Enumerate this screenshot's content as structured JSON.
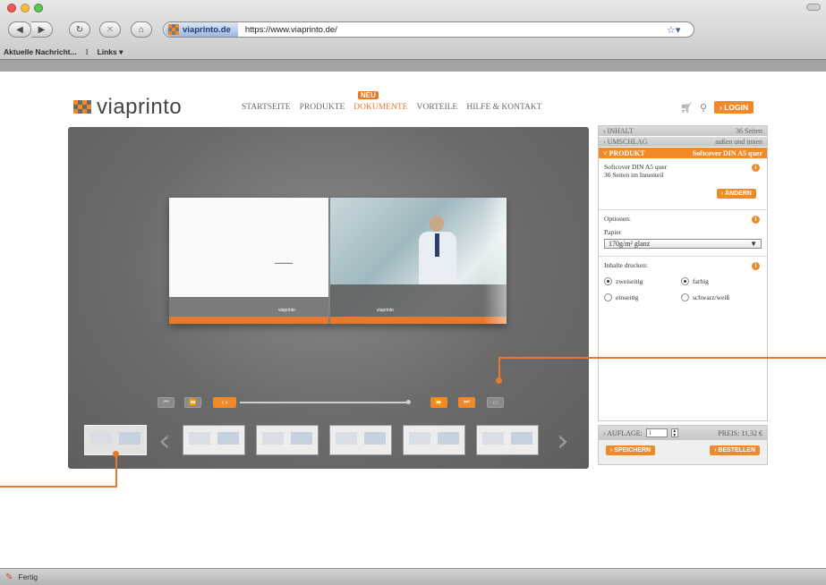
{
  "browser": {
    "site_badge": "viaprinto.de",
    "url": "https://www.viaprinto.de/",
    "star": "☆▾",
    "bookmarks": [
      "Aktuelle Nachricht...",
      "Links ▾"
    ],
    "status": "Fertig"
  },
  "site": {
    "logo_text": "viaprinto",
    "nav": [
      "STARTSEITE",
      "PRODUKTE",
      "DOKUMENTE",
      "VORTEILE",
      "HILFE & KONTAKT"
    ],
    "new_badge": "NEU",
    "login": "› LOGIN"
  },
  "panel": {
    "inhalt_label": "› INHALT",
    "inhalt_value": "36 Seiten",
    "umschlag_label": "› UMSCHLAG",
    "umschlag_value": "außen und innen",
    "produkt_label": "˅ PRODUKT",
    "produkt_value": "Softcover DIN A5 quer",
    "product_line1": "Softcover DIN A5 quer",
    "product_line2": "36 Seiten im Innenteil",
    "andern": "› ÄNDERN",
    "optionen": "Optionen:",
    "papier": "Papier",
    "paper_value": "170g/m² glanz",
    "inhalte_drucken": "Inhalte drucken:",
    "opt_zweiseitig": "zweiseitig",
    "opt_einseitig": "einseitig",
    "opt_farbig": "farbig",
    "opt_schwarz": "schwarz/weiß",
    "auflage_label": "› AUFLAGE:",
    "auflage_value": "1",
    "preis": "PREIS: 11,32 €",
    "speichern": "› SPEICHERN",
    "bestellen": "› BESTELLEN"
  },
  "viewer": {
    "left_logo": "viaprinto",
    "right_logo": "viaprinto"
  },
  "colors": {
    "accent": "#f08a28",
    "callout": "#e8792a"
  }
}
